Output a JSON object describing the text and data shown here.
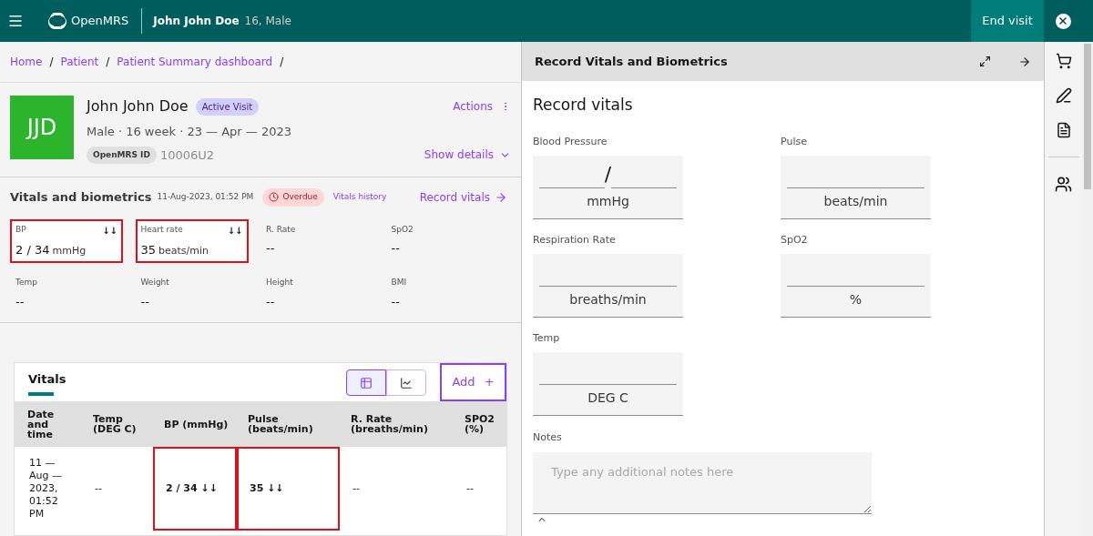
{
  "header": {
    "brand": "OpenMRS",
    "patient_name": "John John Doe",
    "patient_info": "16, Male",
    "end_visit": "End visit"
  },
  "breadcrumbs": [
    "Home",
    "Patient",
    "Patient Summary dashboard"
  ],
  "breadcrumb_separator": "/",
  "patient": {
    "initials": "JJD",
    "name": "John John Doe",
    "badge": "Active Visit",
    "details": "Male · 16 week · 23 — Apr — 2023",
    "id_label": "OpenMRS ID",
    "id_value": "10006U2",
    "actions": "Actions",
    "show_details": "Show details"
  },
  "vitals_summary": {
    "title": "Vitals and biometrics",
    "timestamp": "11-Aug-2023, 01:52 PM",
    "status": "Overdue",
    "history_link": "Vitals history",
    "record_link": "Record vitals",
    "tiles": [
      {
        "label": "BP",
        "arrows": "↓↓",
        "value": "2 / 34",
        "unit": "mmHg",
        "highlighted": true
      },
      {
        "label": "Heart rate",
        "arrows": "↓↓",
        "value": "35",
        "unit": "beats/min",
        "highlighted": true
      },
      {
        "label": "R. Rate",
        "value": "--",
        "highlighted": false
      },
      {
        "label": "SpO2",
        "value": "--",
        "highlighted": false
      },
      {
        "label": "Temp",
        "value": "--",
        "highlighted": false
      },
      {
        "label": "Weight",
        "value": "--",
        "highlighted": false
      },
      {
        "label": "Height",
        "value": "--",
        "highlighted": false
      },
      {
        "label": "BMI",
        "value": "--",
        "highlighted": false
      }
    ]
  },
  "vitals_table": {
    "title": "Vitals",
    "views": [
      {
        "kind": "table",
        "selected": true
      },
      {
        "kind": "chart",
        "selected": false
      }
    ],
    "add_button": "Add",
    "add_icon": "+",
    "columns": [
      "Date and time",
      "Temp (DEG C)",
      "BP (mmHg)",
      "Pulse (beats/min)",
      "R. Rate (breaths/min)",
      "SPO2 (%)"
    ],
    "rows": [
      [
        {
          "text": "11 — Aug — 2023, 01:52 PM",
          "highlighted": false
        },
        {
          "text": "--",
          "highlighted": false
        },
        {
          "text": "2 / 34 ↓↓",
          "highlighted": true
        },
        {
          "text": "35 ↓↓",
          "highlighted": true
        },
        {
          "text": "--",
          "highlighted": false
        },
        {
          "text": "--",
          "highlighted": false
        }
      ]
    ]
  },
  "panel": {
    "title": "Record Vitals and Biometrics",
    "heading": "Record vitals",
    "fields": [
      {
        "kind": "pair",
        "label": "Blood Pressure",
        "separator": "/",
        "unit": "mmHg"
      },
      {
        "kind": "single",
        "label": "Pulse",
        "unit": "beats/min"
      },
      {
        "kind": "single",
        "label": "Respiration Rate",
        "unit": "breaths/min"
      },
      {
        "kind": "single",
        "label": "SpO2",
        "unit": "%"
      },
      {
        "kind": "single",
        "label": "Temp",
        "unit": "DEG C"
      }
    ],
    "notes_label": "Notes",
    "notes_placeholder": "Type any additional notes here"
  }
}
